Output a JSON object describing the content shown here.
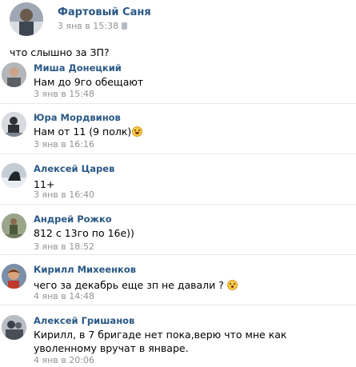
{
  "post": {
    "author": "Фартовый Саня",
    "time": "3 янв в 15:38",
    "text": "что слышно за ЗП?"
  },
  "comments": [
    {
      "author": "Миша Донецкий",
      "text": "Нам до 9го обещают",
      "date": "3 янв в 15:48"
    },
    {
      "author": "Юра Мордвинов",
      "text": "Нам от 11 (9 полк)",
      "date": "3 янв в 16:16"
    },
    {
      "author": "Алексей Царев",
      "text": "11+",
      "date": "3 янв в 16:40"
    },
    {
      "author": "Андрей Рожко",
      "text": "812 с 13го по 16е))",
      "date": "3 янв в 18:52"
    },
    {
      "author": "Кирилл Михеенков",
      "text": "чего за декабрь еще зп не давали ?",
      "date": "4 янв в 14:48"
    },
    {
      "author": "Алексей Гришанов",
      "text": "Кирилл, в 7 бригаде нет пока,верю что мне как уволенному вручат в январе.",
      "date": "4 янв в 20:06"
    }
  ],
  "icons": {
    "timestamp_icon": "phone-icon",
    "emoji_grin": "grinning-emoji",
    "emoji_shock": "astonished-emoji"
  },
  "colors": {
    "author_link": "#2a5885",
    "date_gray": "#939393",
    "divider": "#e7e8ec"
  }
}
